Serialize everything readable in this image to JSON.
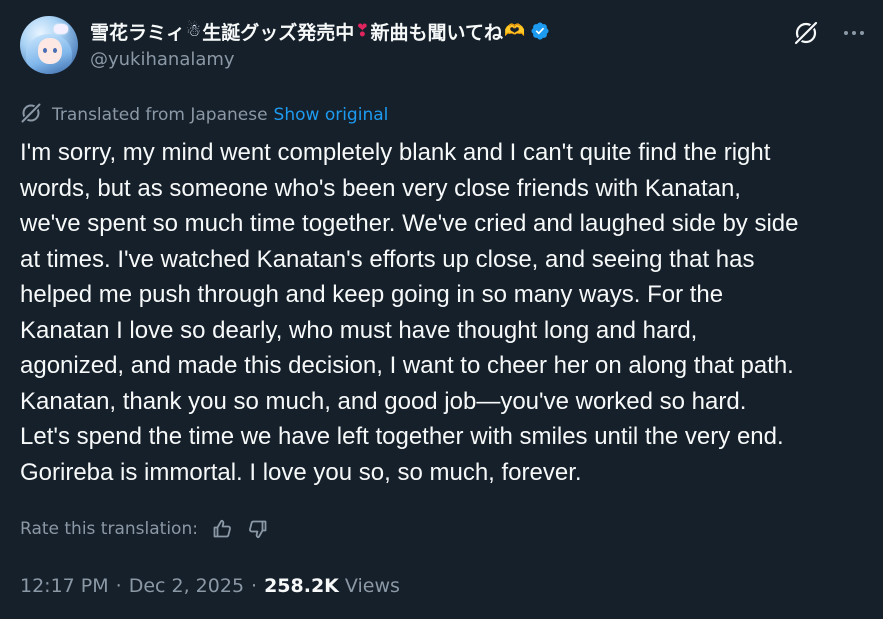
{
  "post": {
    "display_name_part1": "雪花ラミィ",
    "emoji_snowman": "☃",
    "display_name_part2": "生誕グッズ発売中",
    "emoji_heart": "❣",
    "display_name_part3": "新曲も聞いてね",
    "emoji_hands": "🫶",
    "handle": "@yukihanalamy",
    "translated_from": "Translated from Japanese",
    "show_original": "Show original",
    "text": "I'm sorry, my mind went completely blank and I can't quite find the right\nwords, but as someone who's been very close friends with Kanatan,\nwe've spent so much time together. We've cried and laughed side by side\nat times. I've watched Kanatan's efforts up close, and seeing that has\nhelped me push through and keep going in so many ways. For the\nKanatan I love so dearly, who must have thought long and hard,\nagonized, and made this decision, I want to cheer her on along that path.\nKanatan, thank you so much, and good job—you've worked so hard.\nLet's spend the time we have left together with smiles until the very end.\nGorireba is immortal. I love you so, so much, forever.",
    "rate_label": "Rate this translation:",
    "time": "12:17 PM",
    "date": "Dec 2, 2025",
    "separator": "·",
    "views_count": "258.2K",
    "views_label": "Views"
  },
  "icons": {
    "verified": "verified-badge-icon",
    "grok": "grok-icon",
    "more": "more-options-icon",
    "translate": "translate-icon",
    "thumbs_up": "thumbs-up-icon",
    "thumbs_down": "thumbs-down-icon"
  },
  "colors": {
    "background": "#15202b",
    "text": "#f7f9f9",
    "secondary": "#8b98a5",
    "link": "#1d9bf0",
    "verified": "#1d9bf0",
    "heart": "#e0245e"
  }
}
